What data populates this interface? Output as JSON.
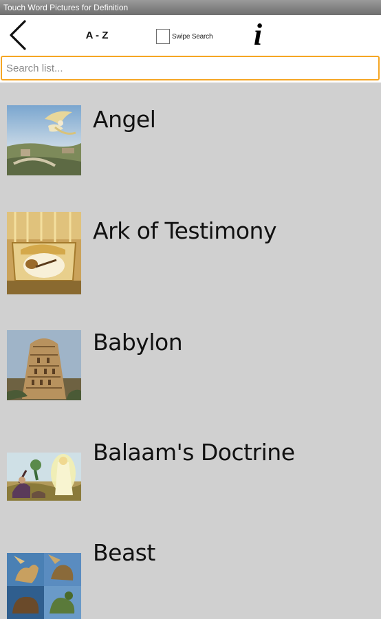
{
  "window": {
    "title": "Touch Word Pictures for Definition"
  },
  "toolbar": {
    "back_icon": "chevron-left-icon",
    "sort_label": "A - Z",
    "swipe_search_label": "Swipe Search",
    "swipe_search_checked": false,
    "info_label": "i"
  },
  "search": {
    "placeholder": "Search list...",
    "value": ""
  },
  "colors": {
    "background": "#d0d0d0",
    "search_border": "#f5a623",
    "titlebar": "#7a7a7a"
  },
  "list": {
    "items": [
      {
        "label": "Angel",
        "image": "angel-painting"
      },
      {
        "label": "Ark of Testimony",
        "image": "ark-of-covenant-painting"
      },
      {
        "label": "Babylon",
        "image": "tower-of-babel-painting"
      },
      {
        "label": "Balaam's Doctrine",
        "image": "balaam-and-angel-painting"
      },
      {
        "label": "Beast",
        "image": "beasts-collage"
      }
    ]
  }
}
